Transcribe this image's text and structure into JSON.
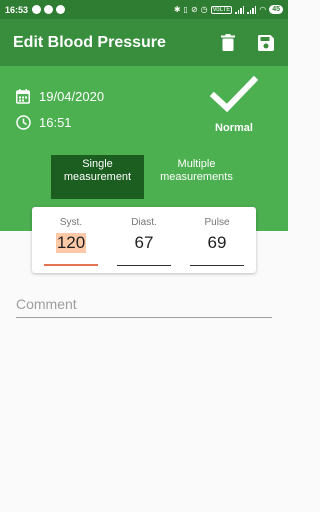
{
  "status_bar": {
    "time": "16:53",
    "volte": "VoLTE",
    "battery": "45"
  },
  "app_bar": {
    "title": "Edit Blood Pressure",
    "delete_icon": "trash-icon",
    "save_icon": "save-icon"
  },
  "record": {
    "date": "19/04/2020",
    "time": "16:51",
    "status": "Normal"
  },
  "mode_toggle": {
    "single": "Single measurement",
    "multiple": "Multiple measurements",
    "selected": "single"
  },
  "measurements": {
    "systolic_label": "Syst.",
    "systolic_value": "120",
    "diastolic_label": "Diast.",
    "diastolic_value": "67",
    "pulse_label": "Pulse",
    "pulse_value": "69"
  },
  "comment": {
    "placeholder": "Comment",
    "value": ""
  },
  "colors": {
    "status_bar": "#2e7d32",
    "app_bar": "#388e3c",
    "header": "#4caf50",
    "toggle_selected": "#1b5e20",
    "accent": "#e57351"
  }
}
